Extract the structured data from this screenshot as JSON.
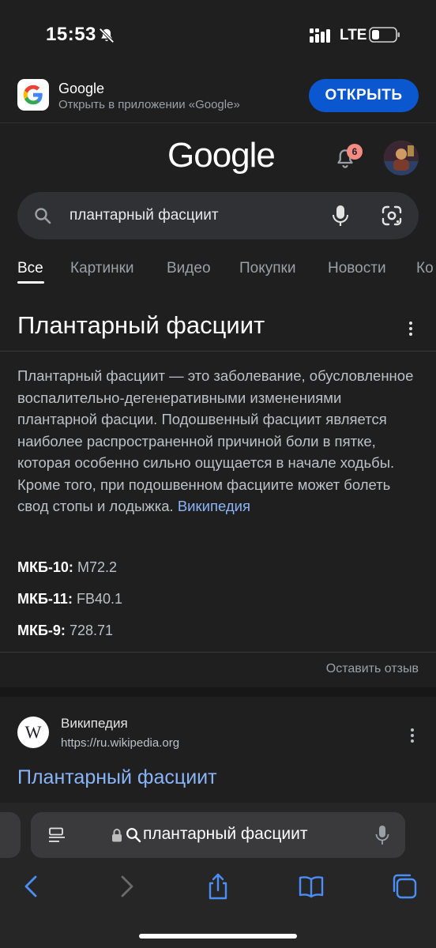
{
  "status_bar": {
    "time": "15:53",
    "network": "LTE"
  },
  "banner": {
    "app_name": "Google",
    "subtitle": "Открыть в приложении «Google»",
    "open_label": "ОТКРЫТЬ"
  },
  "header": {
    "logo": "Google",
    "notification_count": "6"
  },
  "search": {
    "query": "плантарный фасциит"
  },
  "tabs": [
    {
      "label": "Все",
      "active": true
    },
    {
      "label": "Картинки"
    },
    {
      "label": "Видео"
    },
    {
      "label": "Покупки"
    },
    {
      "label": "Новости"
    },
    {
      "label": "Ко"
    }
  ],
  "knowledge_panel": {
    "title": "Плантарный фасциит",
    "description": "Плантарный фасциит — это заболевание, обусловленное воспалительно-дегенеративными изменениями плантарной фасции. Подошвенный фасциит является наиболее распространенной причиной боли в пятке, которая особенно сильно ощущается в начале ходьбы. Кроме того, при подошвенном фасциите может болеть свод стопы и лодыжка.",
    "source_link": "Википедия",
    "facts": [
      {
        "label": "МКБ-10:",
        "value": "M72.2"
      },
      {
        "label": "МКБ-11:",
        "value": "FB40.1"
      },
      {
        "label": "МКБ-9:",
        "value": "728.71"
      }
    ],
    "feedback": "Оставить отзыв"
  },
  "result": {
    "site_name": "Википедия",
    "url": "https://ru.wikipedia.org",
    "title": "Плантарный фасциит",
    "favicon_letter": "W"
  },
  "safari": {
    "address_text": "плантарный фасциит"
  },
  "colors": {
    "background": "#1f1f1f",
    "link": "#8ab4f8",
    "open_button": "#0b57d0",
    "badge": "#f28b82"
  }
}
